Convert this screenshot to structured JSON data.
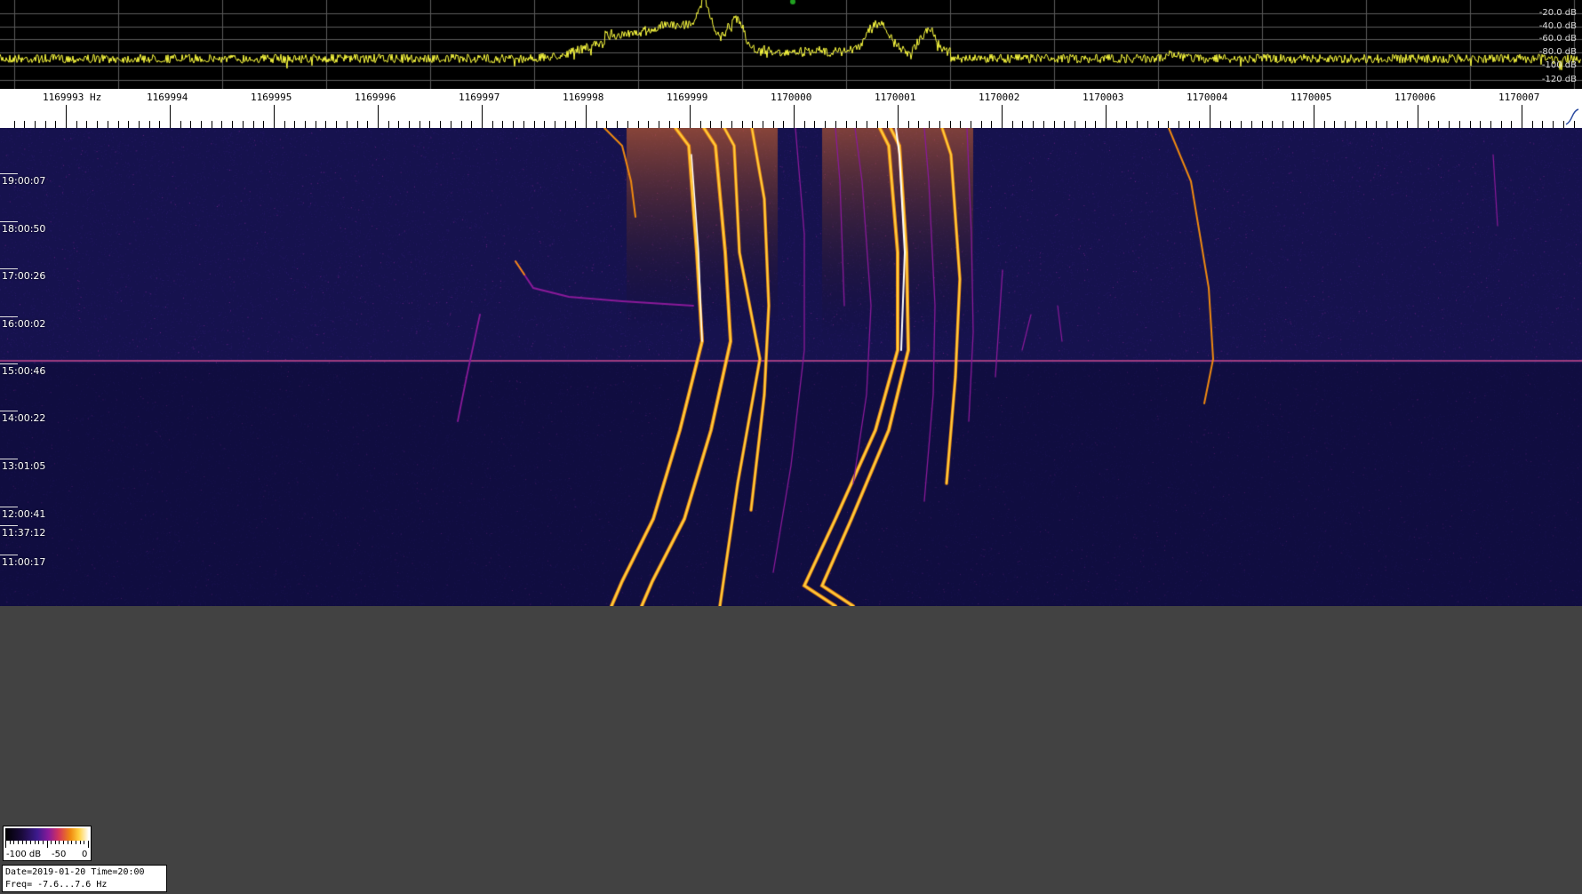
{
  "spectrum": {
    "db_labels": [
      "-20.0 dB",
      "-40.0 dB",
      "-60.0 dB",
      "-80.0 dB",
      "-100 dB",
      "-120 dB"
    ],
    "trace_color": "#ffff40",
    "grid_color": "#5a5a5a"
  },
  "ruler": {
    "freq_labels": [
      "1169993 Hz",
      "1169994",
      "1169995",
      "1169996",
      "1169997",
      "1169998",
      "1169999",
      "1170000",
      "1170001",
      "1170002",
      "1170003",
      "1170004",
      "1170005",
      "1170006",
      "1170007"
    ]
  },
  "waterfall": {
    "time_labels": [
      "19:00:07",
      "18:00:50",
      "17:00:26",
      "16:00:02",
      "15:00:46",
      "14:00:22",
      "13:01:05",
      "12:00:41",
      "11:37:12",
      "11:00:17"
    ],
    "background_color": "#16124e",
    "signal_colors": [
      "#3c1a8c",
      "#8a1a9a",
      "#f08a10",
      "#ffd040",
      "#ffffff"
    ]
  },
  "colorbar": {
    "labels": [
      "-100 dB",
      "-50",
      "0"
    ]
  },
  "info": {
    "line1": "Date=2019-01-20 Time=20:00",
    "line2": "Freq= -7.6...7.6 Hz"
  },
  "icons": {
    "corner": "scale-toggle-icon"
  }
}
